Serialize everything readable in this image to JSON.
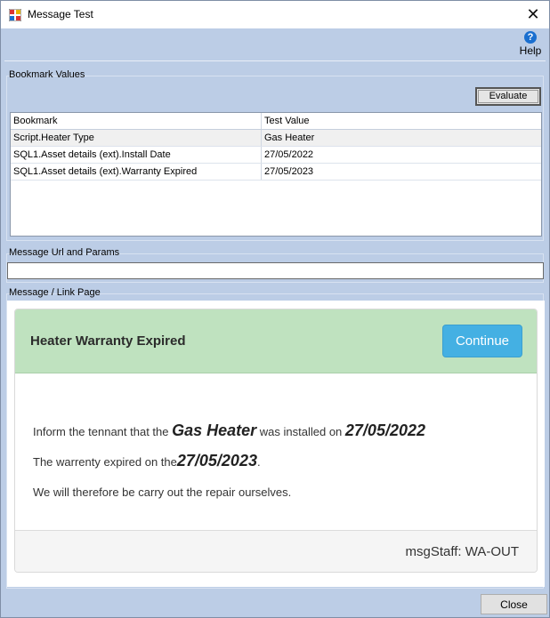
{
  "window": {
    "title": "Message Test"
  },
  "toolbar": {
    "help_label": "Help"
  },
  "bookmarks": {
    "group_label": "Bookmark Values",
    "evaluate_label": "Evaluate",
    "columns": [
      "Bookmark",
      "Test Value"
    ],
    "rows": [
      [
        "Script.Heater Type",
        "Gas Heater"
      ],
      [
        "SQL1.Asset details (ext).Install Date",
        "27/05/2022"
      ],
      [
        "SQL1.Asset details (ext).Warranty Expired",
        "27/05/2023"
      ]
    ]
  },
  "url": {
    "group_label": "Message Url and Params",
    "value": ""
  },
  "page": {
    "group_label": "Message / Link Page",
    "card_title": "Heater Warranty Expired",
    "continue_label": "Continue",
    "line1_prefix": "Inform the tennant that the ",
    "line1_heater": "Gas Heater",
    "line1_mid": " was installed on ",
    "line1_date": "27/05/2022",
    "line2_prefix": "The warrenty expired on the",
    "line2_date": "27/05/2023",
    "line2_suffix": ".",
    "line3": "We will therefore be carry out the repair ourselves.",
    "footer": "msgStaff: WA-OUT"
  },
  "footer": {
    "close_label": "Close"
  },
  "colors": {
    "window_bg": "#bccde6",
    "card_head": "#bfe2bf",
    "continue_bg": "#44b0e3",
    "help_icon": "#1a6fcf"
  }
}
